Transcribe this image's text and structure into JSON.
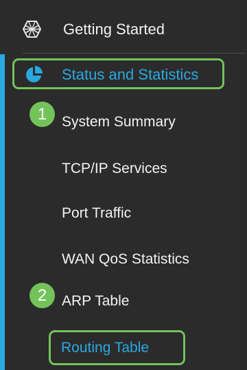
{
  "nav": {
    "getting_started": {
      "label": "Getting Started",
      "icon": "hexagon-globe-icon"
    },
    "status_and_statistics": {
      "label": "Status and Statistics",
      "icon": "pie-chart-icon",
      "selected": true
    },
    "sub_items": [
      {
        "label": "System Summary"
      },
      {
        "label": "TCP/IP Services"
      },
      {
        "label": "Port Traffic"
      },
      {
        "label": "WAN QoS Statistics"
      },
      {
        "label": "ARP Table"
      },
      {
        "label": "Routing Table",
        "selected": true
      }
    ]
  },
  "callouts": [
    "1",
    "2"
  ],
  "colors": {
    "background": "#2b2b2c",
    "accent_blue": "#29a9e0",
    "highlight_green": "#74c35a",
    "text": "#f2f2f2"
  }
}
